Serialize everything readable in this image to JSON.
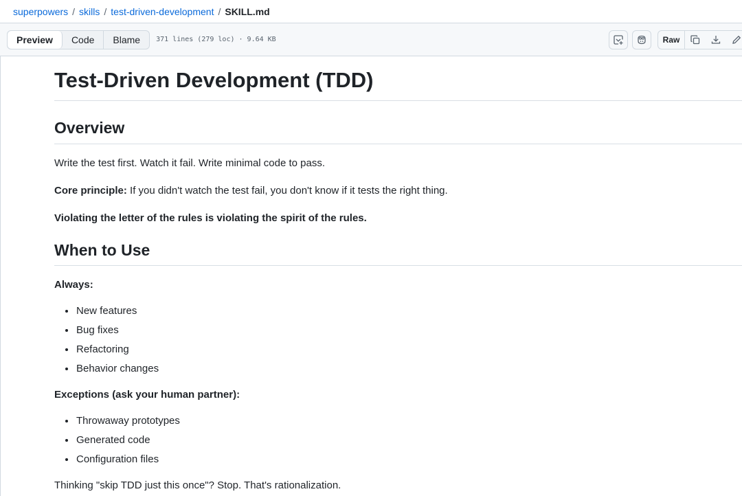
{
  "breadcrumb": {
    "repo": "superpowers",
    "sep1": "/",
    "folder1": "skills",
    "sep2": "/",
    "folder2": "test-driven-development",
    "sep3": "/",
    "file": "SKILL.md"
  },
  "file_header": {
    "tabs": [
      "Preview",
      "Code",
      "Blame"
    ],
    "meta": "371 lines (279 loc) · 9.64 KB",
    "raw_label": "Raw",
    "icons": [
      "symbols-panel-icon",
      "copilot-icon",
      "copy-icon",
      "download-icon",
      "edit-icon"
    ]
  },
  "content": {
    "title": "Test-Driven Development (TDD)",
    "overview_heading": "Overview",
    "overview_text": "Write the test first. Watch it fail. Write minimal code to pass.",
    "core_label": "Core principle:",
    "core_text": " If you didn't watch the test fail, you don't know if it tests the right thing.",
    "violating_text": "Violating the letter of the rules is violating the spirit of the rules.",
    "when_heading": "When to Use",
    "always_label": "Always:",
    "always_items": [
      "New features",
      "Bug fixes",
      "Refactoring",
      "Behavior changes"
    ],
    "exceptions_label": "Exceptions (ask your human partner):",
    "exception_items": [
      "Throwaway prototypes",
      "Generated code",
      "Configuration files"
    ],
    "footer_text": "Thinking \"skip TDD just this once\"? Stop. That's rationalization."
  },
  "colors": {
    "link": "#0969da",
    "text": "#1f2328",
    "muted": "#59636e",
    "border": "#d1d9e0",
    "header_bg": "#f6f8fa"
  }
}
